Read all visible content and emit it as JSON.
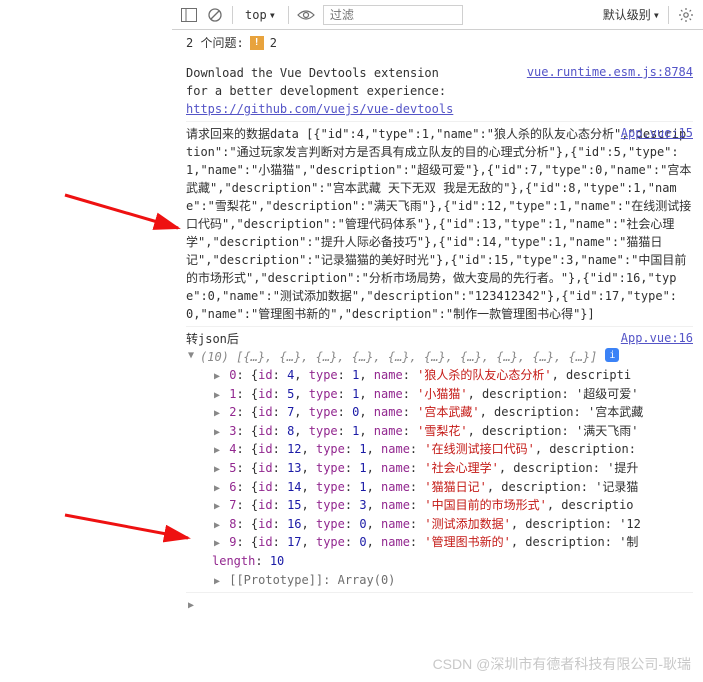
{
  "toolbar": {
    "context": "top",
    "filter_placeholder": "过滤",
    "level": "默认级别"
  },
  "issues": {
    "label": "2 个问题:",
    "count": "2"
  },
  "msg1": {
    "line1": "Download the Vue Devtools extension",
    "line2": "for a better development experience:",
    "link": "https://github.com/vuejs/vue-devtools",
    "src": "vue.runtime.esm.js:8784"
  },
  "msg2": {
    "src": "App.vue:15",
    "text": "请求回来的数据data [{\"id\":4,\"type\":1,\"name\":\"狼人杀的队友心态分析\",\"description\":\"通过玩家发言判断对方是否具有成立队友的目的心理式分析\"},{\"id\":5,\"type\":1,\"name\":\"小猫猫\",\"description\":\"超级可爱\"},{\"id\":7,\"type\":0,\"name\":\"宫本武藏\",\"description\":\"宫本武藏 天下无双 我是无敌的\"},{\"id\":8,\"type\":1,\"name\":\"雪梨花\",\"description\":\"满天飞雨\"},{\"id\":12,\"type\":1,\"name\":\"在线测试接口代码\",\"description\":\"管理代码体系\"},{\"id\":13,\"type\":1,\"name\":\"社会心理学\",\"description\":\"提升人际必备技巧\"},{\"id\":14,\"type\":1,\"name\":\"猫猫日记\",\"description\":\"记录猫猫的美好时光\"},{\"id\":15,\"type\":3,\"name\":\"中国目前的市场形式\",\"description\":\"分析市场局势，做大变局的先行者。\"},{\"id\":16,\"type\":0,\"name\":\"测试添加数据\",\"description\":\"123412342\"},{\"id\":17,\"type\":0,\"name\":\"管理图书新的\",\"description\":\"制作一款管理图书心得\"}]"
  },
  "msg3": {
    "label": "转json后",
    "src": "App.vue:16",
    "count": "(10)",
    "preview": "[{…}, {…}, {…}, {…}, {…}, {…}, {…}, {…}, {…}, {…}]",
    "items": [
      {
        "idx": "0",
        "id": "4",
        "type": "1",
        "name": "'狼人杀的队友心态分析'",
        "tail": ", descripti"
      },
      {
        "idx": "1",
        "id": "5",
        "type": "1",
        "name": "'小猫猫'",
        "tail": ", description: '超级可爱'"
      },
      {
        "idx": "2",
        "id": "7",
        "type": "0",
        "name": "'宫本武藏'",
        "tail": ", description: '宫本武藏"
      },
      {
        "idx": "3",
        "id": "8",
        "type": "1",
        "name": "'雪梨花'",
        "tail": ", description: '满天飞雨'"
      },
      {
        "idx": "4",
        "id": "12",
        "type": "1",
        "name": "'在线测试接口代码'",
        "tail": ", description:"
      },
      {
        "idx": "5",
        "id": "13",
        "type": "1",
        "name": "'社会心理学'",
        "tail": ", description: '提升"
      },
      {
        "idx": "6",
        "id": "14",
        "type": "1",
        "name": "'猫猫日记'",
        "tail": ", description: '记录猫"
      },
      {
        "idx": "7",
        "id": "15",
        "type": "3",
        "name": "'中国目前的市场形式'",
        "tail": ", descriptio"
      },
      {
        "idx": "8",
        "id": "16",
        "type": "0",
        "name": "'测试添加数据'",
        "tail": ", description: '12"
      },
      {
        "idx": "9",
        "id": "17",
        "type": "0",
        "name": "'管理图书新的'",
        "tail": ", description: '制"
      }
    ],
    "length_label": "length",
    "length_val": "10",
    "proto": "[[Prototype]]: Array(0)"
  },
  "watermark": "CSDN @深圳市有德者科技有限公司-耿瑞"
}
